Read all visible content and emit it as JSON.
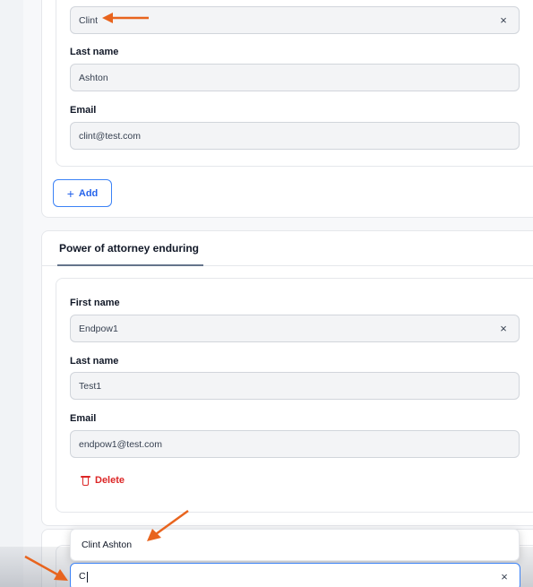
{
  "contact_1": {
    "first_name_value": "Clint",
    "last_name_label": "Last name",
    "last_name_value": "Ashton",
    "email_label": "Email",
    "email_value": "clint@test.com",
    "clear_icon": "×"
  },
  "add_button": {
    "icon": "+",
    "label": "Add"
  },
  "poa_section": {
    "title": "Power of attorney enduring",
    "first_name_label": "First name",
    "first_name_value": "Endpow1",
    "last_name_label": "Last name",
    "last_name_value": "Test1",
    "email_label": "Email",
    "email_value": "endpow1@test.com",
    "delete_label": "Delete",
    "clear_icon": "×"
  },
  "autocomplete": {
    "input_value": "C",
    "suggestions": [
      "Clint Ashton"
    ],
    "clear_icon": "×"
  },
  "colors": {
    "annotation_arrow": "#e8641e",
    "accent_blue": "#2563eb",
    "delete_red": "#dc2626"
  }
}
